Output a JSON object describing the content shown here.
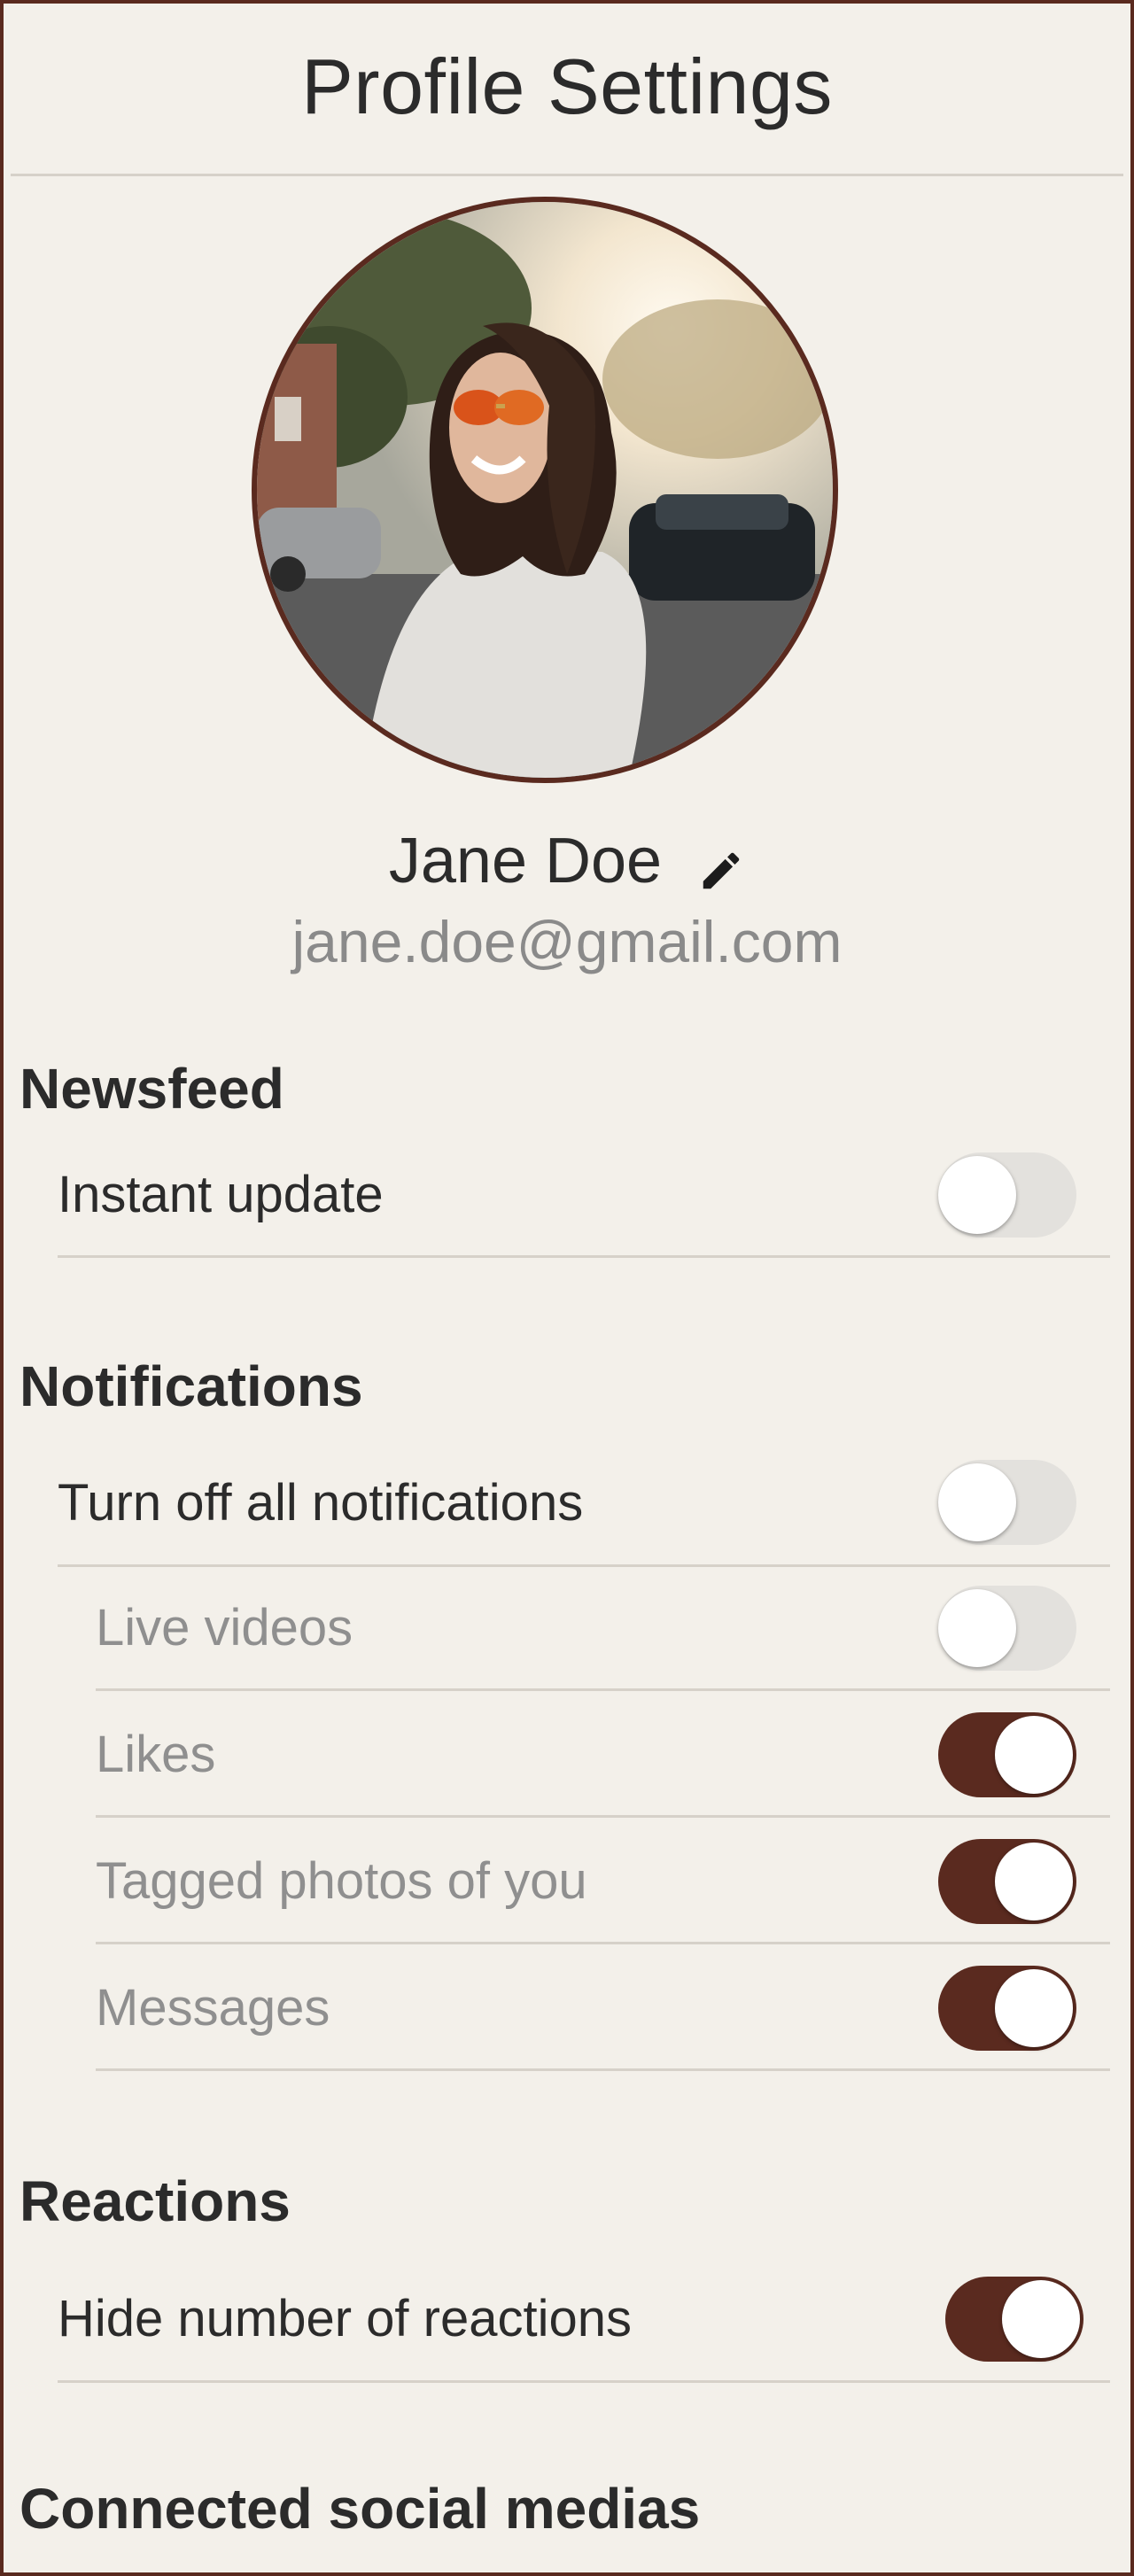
{
  "header": {
    "title": "Profile Settings"
  },
  "profile": {
    "name": "Jane Doe",
    "email": "jane.doe@gmail.com"
  },
  "sections": {
    "newsfeed": {
      "title": "Newsfeed",
      "items": [
        {
          "label": "Instant update",
          "enabled": false
        }
      ]
    },
    "notifications": {
      "title": "Notifications",
      "items": [
        {
          "label": "Turn off all notifications",
          "enabled": false
        },
        {
          "label": "Live videos",
          "enabled": false
        },
        {
          "label": "Likes",
          "enabled": true
        },
        {
          "label": "Tagged photos of you",
          "enabled": true
        },
        {
          "label": "Messages",
          "enabled": true
        }
      ]
    },
    "reactions": {
      "title": "Reactions",
      "items": [
        {
          "label": "Hide number of reactions",
          "enabled": true
        }
      ]
    },
    "connected": {
      "title": "Connected social medias"
    }
  },
  "colors": {
    "accent": "#5a2a1f",
    "background": "#f3f0ea",
    "toggle_off": "#e3e1dd",
    "divider": "#d6d1c9"
  },
  "icons": {
    "edit": "pencil-icon"
  }
}
